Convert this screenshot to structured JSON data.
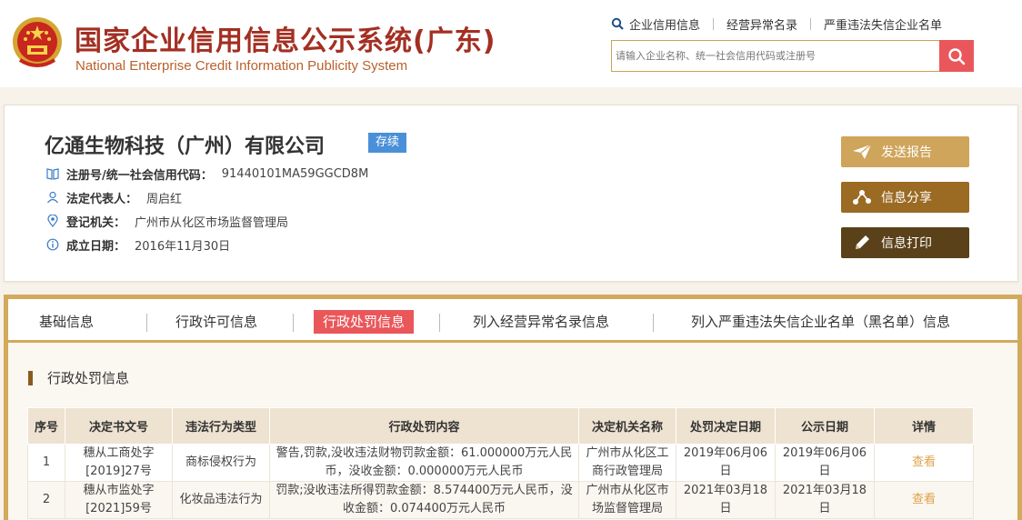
{
  "header": {
    "title_cn": "国家企业信用信息公示系统(广东)",
    "title_en": "National Enterprise Credit Information Publicity System",
    "topnav": [
      "企业信用信息",
      "经营异常名录",
      "严重违法失信企业名单"
    ],
    "search_placeholder": "请输入企业名称、统一社会信用代码或注册号"
  },
  "company": {
    "name": "亿通生物科技（广州）有限公司",
    "status": "存续",
    "reg_label": "注册号/统一社会信用代码：",
    "reg_value": "91440101MA59GGCD8M",
    "rep_label": "法定代表人：",
    "rep_value": "周启红",
    "auth_label": "登记机关：",
    "auth_value": "广州市从化区市场监督管理局",
    "date_label": "成立日期：",
    "date_value": "2016年11月30日"
  },
  "actions": {
    "send_report": "发送报告",
    "share": "信息分享",
    "print": "信息打印"
  },
  "tabs": [
    "基础信息",
    "行政许可信息",
    "行政处罚信息",
    "列入经营异常名录信息",
    "列入严重违法失信企业名单（黑名单）信息"
  ],
  "section_title": "行政处罚信息",
  "table": {
    "headers": [
      "序号",
      "决定书文号",
      "违法行为类型",
      "行政处罚内容",
      "决定机关名称",
      "处罚决定日期",
      "公示日期",
      "详情"
    ],
    "rows": [
      {
        "no": "1",
        "doc_no": "穗从工商处字[2019]27号",
        "type": "商标侵权行为",
        "content": "警告,罚款,没收违法财物罚款金额：61.000000万元人民币，没收金额：0.000000万元人民币",
        "authority": "广州市从化区工商行政管理局",
        "decision_date": "2019年06月06日",
        "publish_date": "2019年06月06日",
        "detail": "查看"
      },
      {
        "no": "2",
        "doc_no": "穗从市监处字[2021]59号",
        "type": "化妆品违法行为",
        "content": "罚款;没收违法所得罚款金额：8.574400万元人民币，没收金额：0.074400万元人民币",
        "authority": "广州市从化区市场监督管理局",
        "decision_date": "2021年03月18日",
        "publish_date": "2021年03月18日",
        "detail": "查看"
      }
    ]
  },
  "colors": {
    "brand_red": "#a32f22",
    "accent_gold": "#d2aa5c",
    "active_tab": "#e9575b",
    "badge_blue": "#4a90d9"
  }
}
